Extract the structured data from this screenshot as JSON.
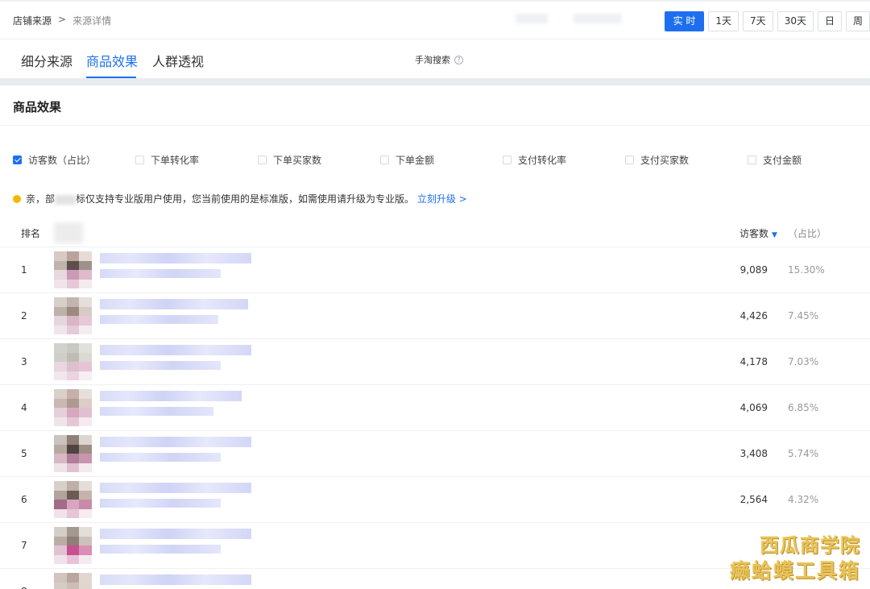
{
  "breadcrumb": {
    "root": "店铺来源",
    "separator": ">",
    "current": "来源详情"
  },
  "time_tabs": [
    {
      "label": "实 时",
      "active": true
    },
    {
      "label": "1天",
      "active": false
    },
    {
      "label": "7天",
      "active": false
    },
    {
      "label": "30天",
      "active": false
    },
    {
      "label": "日",
      "active": false
    },
    {
      "label": "周",
      "active": false
    }
  ],
  "subtabs": [
    {
      "label": "细分来源",
      "active": false
    },
    {
      "label": "商品效果",
      "active": true
    },
    {
      "label": "人群透视",
      "active": false
    }
  ],
  "source_label": "手淘搜索",
  "help_icon": "help-icon",
  "section_title": "商品效果",
  "metrics": [
    {
      "label": "访客数（占比）",
      "checked": true
    },
    {
      "label": "下单转化率",
      "checked": false
    },
    {
      "label": "下单买家数",
      "checked": false
    },
    {
      "label": "下单金额",
      "checked": false
    },
    {
      "label": "支付转化率",
      "checked": false
    },
    {
      "label": "支付买家数",
      "checked": false
    },
    {
      "label": "支付金额",
      "checked": false
    }
  ],
  "notice": {
    "part1": "亲，部",
    "part2": "标仅支持专业版用户使用，您当前使用的是标准版，如需使用请升级为专业版。",
    "link": "立刻升级 >"
  },
  "table": {
    "headers": {
      "rank": "排名",
      "visitors": "访客数",
      "ratio": "（占比）"
    },
    "rows": [
      {
        "rank": "1",
        "visitors": "9,089",
        "ratio": "15.30%"
      },
      {
        "rank": "2",
        "visitors": "4,426",
        "ratio": "7.45%"
      },
      {
        "rank": "3",
        "visitors": "4,178",
        "ratio": "7.03%"
      },
      {
        "rank": "4",
        "visitors": "4,069",
        "ratio": "6.85%"
      },
      {
        "rank": "5",
        "visitors": "3,408",
        "ratio": "5.74%"
      },
      {
        "rank": "6",
        "visitors": "2,564",
        "ratio": "4.32%"
      },
      {
        "rank": "7",
        "visitors": "",
        "ratio": ""
      },
      {
        "rank": "8",
        "visitors": "",
        "ratio": ""
      }
    ]
  },
  "colors": {
    "accent": "#1e6ff0",
    "warning": "#f5b800",
    "watermark": "#e8c25a"
  },
  "watermark": {
    "line1": "西瓜商学院",
    "line2": "癞蛤蟆工具箱"
  }
}
